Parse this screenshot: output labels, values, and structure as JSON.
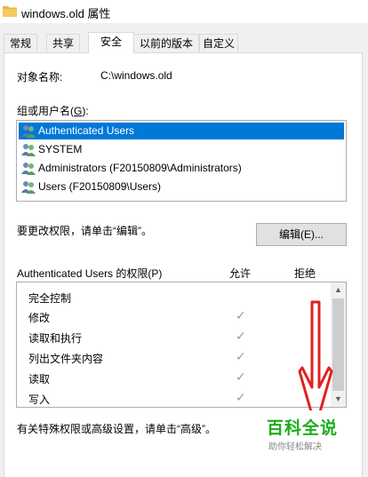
{
  "window": {
    "title": "windows.old 属性"
  },
  "tabs": [
    {
      "label": "常规"
    },
    {
      "label": "共享"
    },
    {
      "label": "安全"
    },
    {
      "label": "以前的版本"
    },
    {
      "label": "自定义"
    }
  ],
  "active_tab": "安全",
  "security": {
    "object_name_label": "对象名称:",
    "object_name_value": "C:\\windows.old",
    "group_label": "组或用户名(",
    "group_label_key": "G",
    "group_label_end": "):",
    "users": [
      {
        "name": "Authenticated Users",
        "selected": true
      },
      {
        "name": "SYSTEM",
        "selected": false
      },
      {
        "name": "Administrators (F20150809\\Administrators)",
        "selected": false
      },
      {
        "name": "Users (F20150809\\Users)",
        "selected": false
      }
    ],
    "change_perm_text": "要更改权限，请单击“编辑”。",
    "edit_button": "编辑(E)...",
    "perm_for_label": "Authenticated Users 的权限(P)",
    "allow_header": "允许",
    "deny_header": "拒绝",
    "permissions": [
      {
        "name": "完全控制",
        "allow": false
      },
      {
        "name": "修改",
        "allow": true
      },
      {
        "name": "读取和执行",
        "allow": true
      },
      {
        "name": "列出文件夹内容",
        "allow": true
      },
      {
        "name": "读取",
        "allow": true
      },
      {
        "name": "写入",
        "allow": true
      }
    ],
    "advanced_text": "有关特殊权限或高级设置，请单击“高级”。"
  },
  "annotation_color": "#e02020",
  "watermark": {
    "main": "百科全说",
    "sub": "助你轻松解决"
  }
}
